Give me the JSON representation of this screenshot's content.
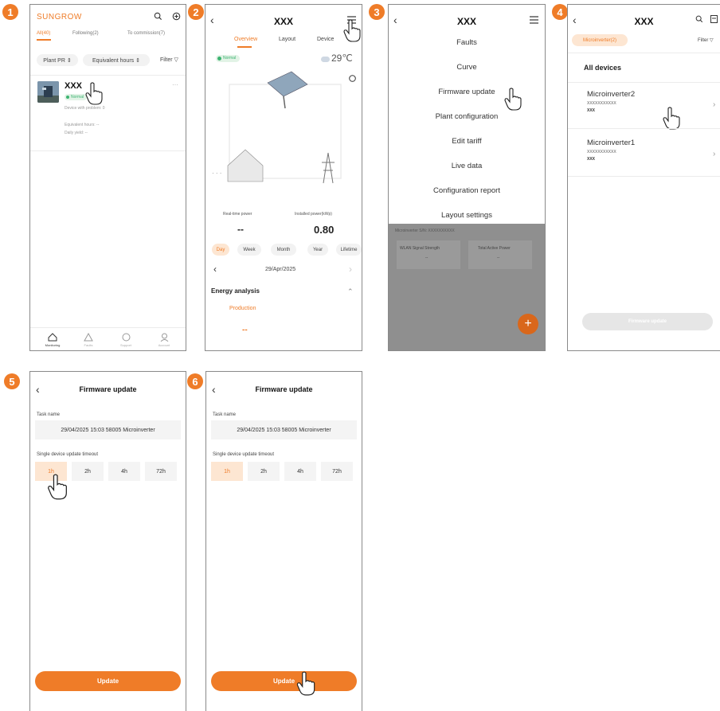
{
  "colors": {
    "accent": "#ef7c28",
    "accent_light": "#fde6d2",
    "overlay": "#8f8f8f"
  },
  "steps": [
    "1",
    "2",
    "3",
    "4",
    "5",
    "6"
  ],
  "icons": [
    "chevron-left-icon",
    "search-icon",
    "plus-circle-icon",
    "menu-icon",
    "help-icon",
    "chevron-right-icon",
    "chevron-up-icon",
    "pointing-hand-icon",
    "home-icon",
    "warning-icon",
    "clock-icon",
    "user-icon"
  ],
  "screen1": {
    "logo": "SUNGROW",
    "tabs": [
      "All(40)",
      "Following(2)",
      "To commission(7)"
    ],
    "filters": [
      "Plant PR ⇕",
      "Equivalent hours ⇕",
      "Filter ▽"
    ],
    "plant": {
      "name": "XXX",
      "status": "Normal",
      "problem": "Device with problem: 0",
      "eq_hours": "Equivalent hours: --",
      "daily_yield": "Daily yield: --",
      "more": "···"
    },
    "nav": [
      "Monitoring",
      "Faults",
      "Support",
      "Account"
    ]
  },
  "screen2": {
    "title": "XXX",
    "tabs": [
      "Overview",
      "Layout",
      "Device"
    ],
    "status": "Normal",
    "temperature": "29℃",
    "real_time_label": "Real-time power",
    "real_time_value": "--",
    "installed_label": "Installed power(kWp)",
    "installed_value": "0.80",
    "periods": [
      "Day",
      "Week",
      "Month",
      "Year",
      "Lifetime"
    ],
    "date": "29/Apr/2025",
    "energy_analysis": "Energy analysis",
    "production": "Production",
    "production_value": "--"
  },
  "screen3": {
    "title": "XXX",
    "menu": [
      "Faults",
      "Curve",
      "Firmware update",
      "Plant configuration",
      "Edit tariff",
      "Live data",
      "Configuration report",
      "Layout settings"
    ],
    "bg_sn": "Microinverter S/N: XXXXXXXXXX",
    "bg_wlan": "WLAN Signal Strength",
    "bg_wlan_val": "--",
    "bg_power": "Total Active Power",
    "bg_power_val": "--",
    "fab": "+"
  },
  "screen4": {
    "title": "XXX",
    "chip": "Microinverter(2)",
    "filter": "Filter ▽",
    "all_devices": "All devices",
    "devices": [
      {
        "name": "Microinverter2",
        "sn": "XXXXXXXXXXX",
        "plant": "XXX"
      },
      {
        "name": "Microinverter1",
        "sn": "XXXXXXXXXXX",
        "plant": "XXX"
      }
    ],
    "button": "Firmware update"
  },
  "screen5": {
    "title": "Firmware update",
    "task_label": "Task name",
    "task_value": "29/04/2025 15:03 58005 Microinverter",
    "timeout_label": "Single device update timeout",
    "options": [
      "1h",
      "2h",
      "4h",
      "72h"
    ],
    "button": "Update"
  },
  "screen6": {
    "title": "Firmware update",
    "task_label": "Task name",
    "task_value": "29/04/2025 15:03 58005 Microinverter",
    "timeout_label": "Single device update timeout",
    "options": [
      "1h",
      "2h",
      "4h",
      "72h"
    ],
    "button": "Update"
  }
}
